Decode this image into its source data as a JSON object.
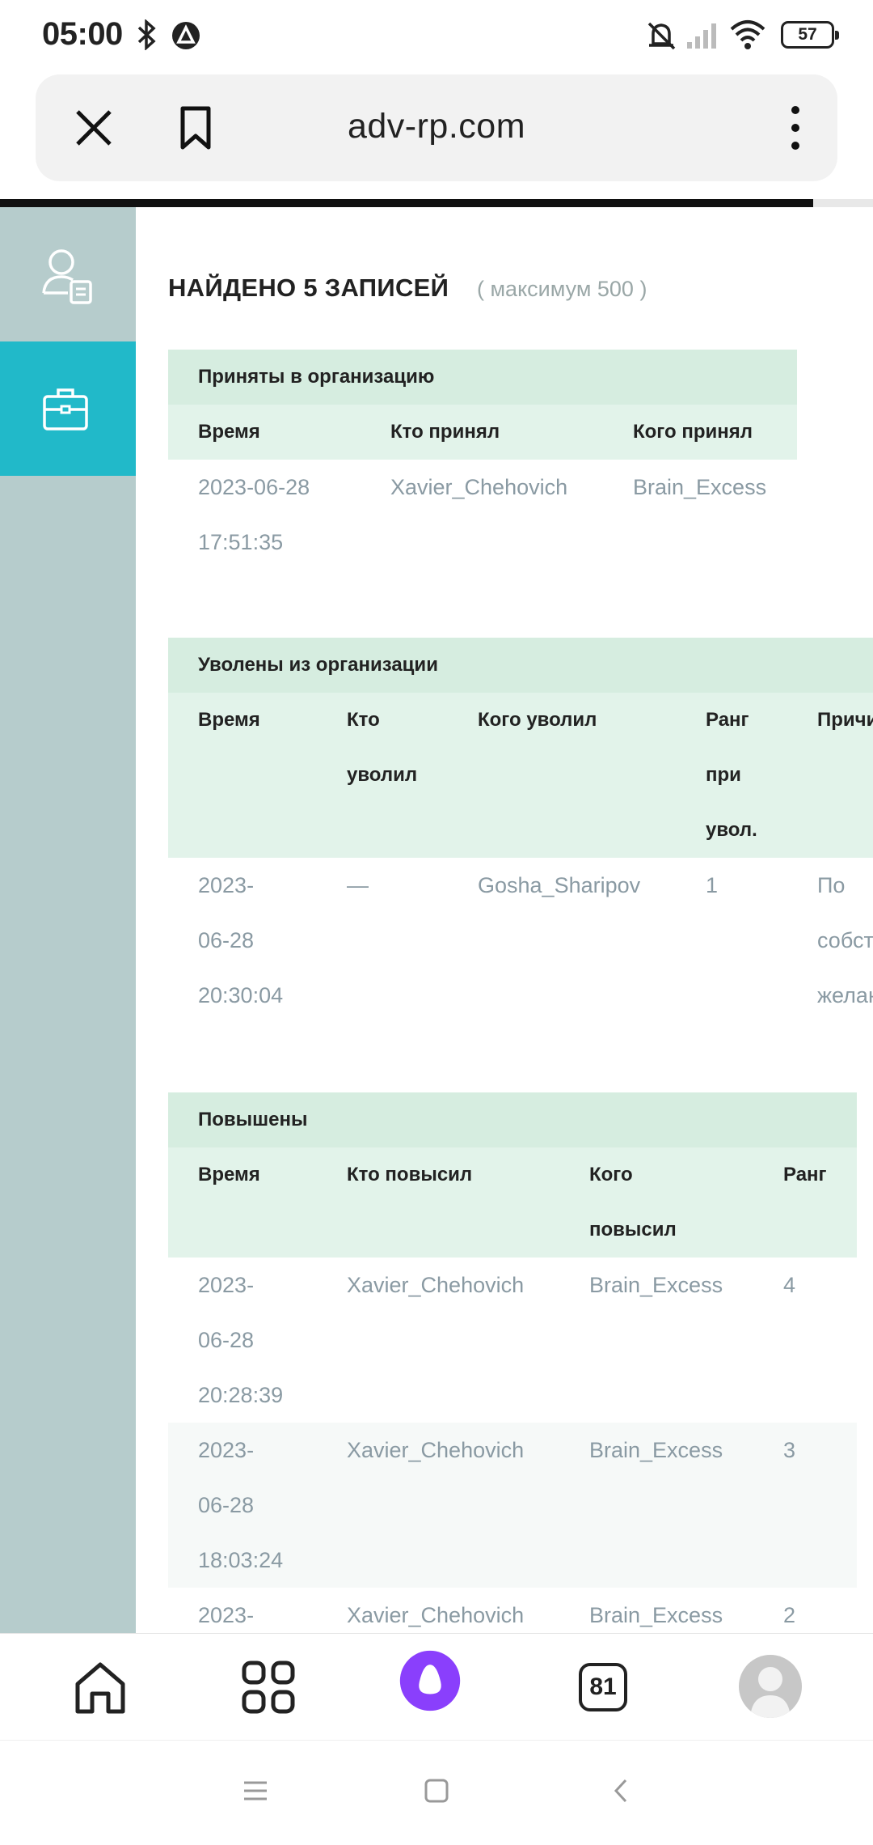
{
  "status_bar": {
    "time": "05:00",
    "battery": "57",
    "icons": [
      "bluetooth-icon",
      "vpn-icon",
      "mute-icon",
      "signal-icon",
      "wifi-icon",
      "battery-icon"
    ]
  },
  "browser": {
    "url": "adv-rp.com",
    "tab_count": "81",
    "close_icon": "close-icon",
    "bookmark_icon": "bookmark-icon",
    "menu_icon": "more-vert-icon"
  },
  "sidebar": {
    "items": [
      {
        "icon": "user-document-icon",
        "active": false
      },
      {
        "icon": "briefcase-icon",
        "active": true
      }
    ],
    "colors": {
      "bg": "#b6cccc",
      "active": "#21b9c9"
    }
  },
  "results": {
    "found_label": "НАЙДЕНО 5 ЗАПИСЕЙ",
    "max_label": "( максимум 500 )"
  },
  "hired": {
    "title": "Приняты в организацию",
    "headers": [
      "Время",
      "Кто принял",
      "Кого принял"
    ],
    "rows": [
      {
        "time_date": "2023-06-28",
        "time_clock": "17:51:35",
        "who": "Xavier_Chehovich",
        "whom": "Brain_Excess"
      }
    ]
  },
  "fired": {
    "title": "Уволены из организации",
    "headers": {
      "time": "Время",
      "who_1": "Кто",
      "who_2": "уволил",
      "whom": "Кого уволил",
      "rank_1": "Ранг",
      "rank_2": "при",
      "rank_3": "увол.",
      "reason": "Причи"
    },
    "rows": [
      {
        "date_1": "2023-",
        "date_2": "06-28",
        "clock": "20:30:04",
        "who": "—",
        "whom": "Gosha_Sharipov",
        "rank": "1",
        "reason_1": "По",
        "reason_2": "собст",
        "reason_3": "желан"
      }
    ]
  },
  "promoted": {
    "title": "Повышены",
    "headers": {
      "time": "Время",
      "who": "Кто повысил",
      "whom_1": "Кого",
      "whom_2": "повысил",
      "rank": "Ранг"
    },
    "rows": [
      {
        "date_1": "2023-",
        "date_2": "06-28",
        "clock": "20:28:39",
        "who": "Xavier_Chehovich",
        "whom": "Brain_Excess",
        "rank": "4"
      },
      {
        "date_1": "2023-",
        "date_2": "06-28",
        "clock": "18:03:24",
        "who": "Xavier_Chehovich",
        "whom": "Brain_Excess",
        "rank": "3"
      },
      {
        "date_1": "2023-",
        "date_2": "",
        "clock": "",
        "who": "Xavier_Chehovich",
        "whom": "Brain_Excess",
        "rank": "2"
      }
    ]
  },
  "bottom_nav": {
    "items": [
      "home-icon",
      "apps-grid-icon",
      "alice-assistant-icon",
      "tabs-icon",
      "avatar"
    ],
    "accent": "#8a3ffc"
  },
  "system_nav": [
    "recents-icon",
    "home-square-icon",
    "back-icon"
  ]
}
